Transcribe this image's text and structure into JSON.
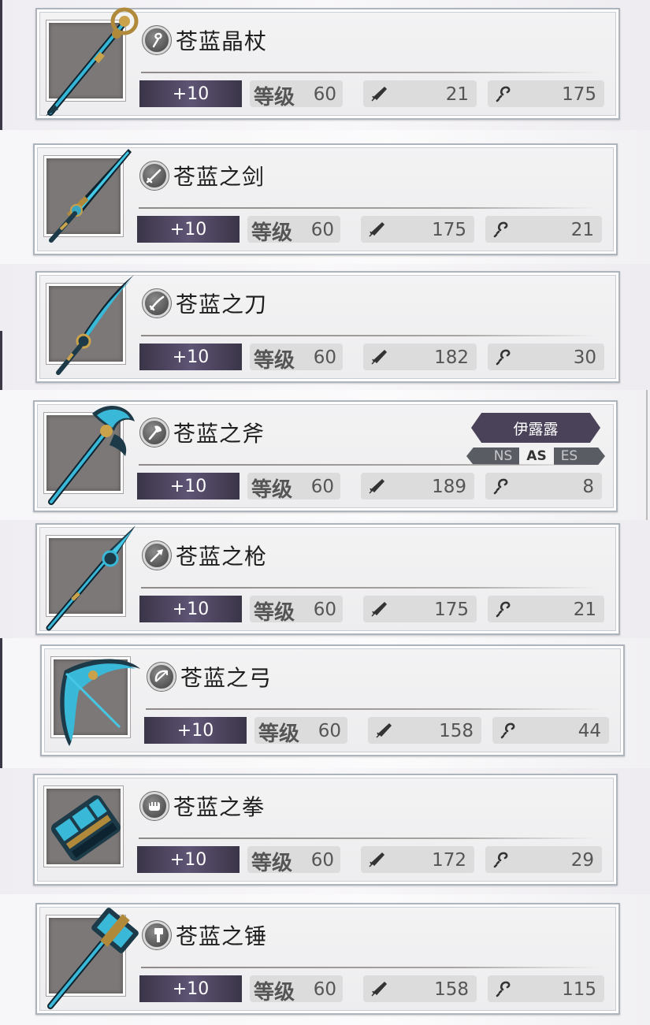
{
  "weapons": [
    {
      "name": "苍蓝晶杖",
      "category_icon": "staff-icon",
      "weapon_icon": "staff",
      "refine": "+10",
      "level_label": "等级",
      "level": "60",
      "atk": "21",
      "mag": "175"
    },
    {
      "name": "苍蓝之剑",
      "category_icon": "sword-icon",
      "weapon_icon": "sword",
      "refine": "+10",
      "level_label": "等级",
      "level": "60",
      "atk": "175",
      "mag": "21"
    },
    {
      "name": "苍蓝之刀",
      "category_icon": "katana-icon",
      "weapon_icon": "katana",
      "refine": "+10",
      "level_label": "等级",
      "level": "60",
      "atk": "182",
      "mag": "30"
    },
    {
      "name": "苍蓝之斧",
      "category_icon": "axe-icon",
      "weapon_icon": "axe",
      "refine": "+10",
      "level_label": "等级",
      "level": "60",
      "atk": "189",
      "mag": "8",
      "equipped": {
        "character": "伊露露",
        "tags": [
          "NS",
          "AS",
          "ES"
        ],
        "active_tag": "AS"
      }
    },
    {
      "name": "苍蓝之枪",
      "category_icon": "spear-icon",
      "weapon_icon": "spear",
      "refine": "+10",
      "level_label": "等级",
      "level": "60",
      "atk": "175",
      "mag": "21"
    },
    {
      "name": "苍蓝之弓",
      "category_icon": "bow-icon",
      "weapon_icon": "bow",
      "refine": "+10",
      "level_label": "等级",
      "level": "60",
      "atk": "158",
      "mag": "44"
    },
    {
      "name": "苍蓝之拳",
      "category_icon": "fist-icon",
      "weapon_icon": "gauntlet",
      "refine": "+10",
      "level_label": "等级",
      "level": "60",
      "atk": "172",
      "mag": "29"
    },
    {
      "name": "苍蓝之锤",
      "category_icon": "hammer-icon",
      "weapon_icon": "hammer",
      "refine": "+10",
      "level_label": "等级",
      "level": "60",
      "atk": "158",
      "mag": "115"
    }
  ],
  "colors": {
    "refine_bg": "#4a4258",
    "stat_pill": "#dcdcdc",
    "weapon_blue": "#2fb8d8",
    "thumb_bg": "#7d7878"
  }
}
